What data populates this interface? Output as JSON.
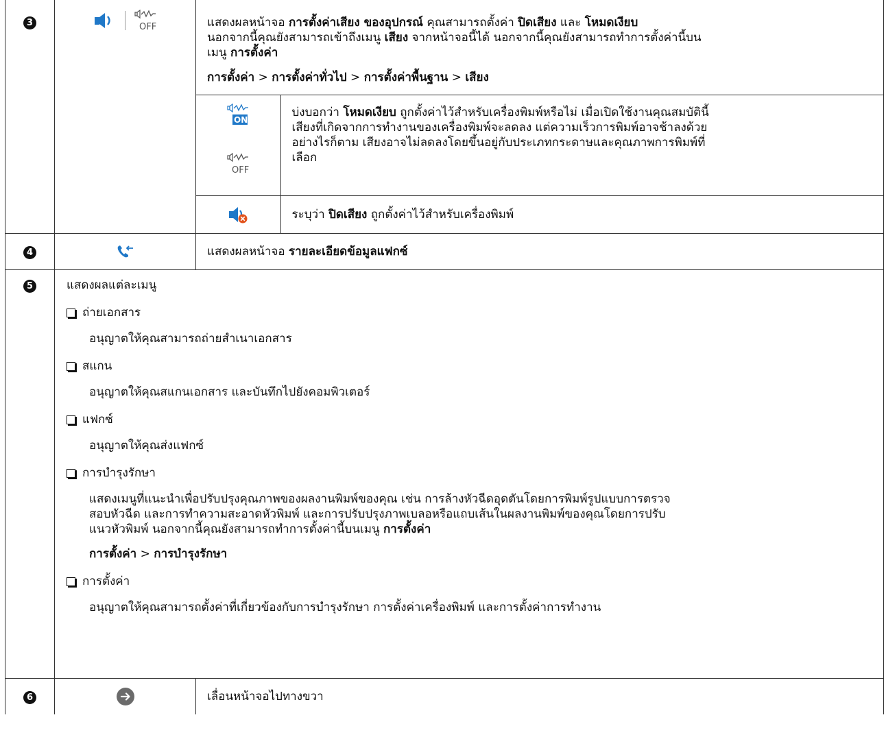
{
  "rows": [
    {
      "num": "3",
      "desc_line1": {
        "t1": "แสดงผลหน้าจอ ",
        "b1": "การตั้งค่าเสียง ของอุปกรณ์",
        "t2": " คุณสามารถตั้งค่า ",
        "b2": "ปิดเสียง",
        "t3": " และ ",
        "b3": "โหมดเงียบ"
      },
      "desc_line2": {
        "t1": "นอกจากนี้คุณยังสามารถเข้าถึงเมนู ",
        "b1": "เสียง",
        "t2": " จากหน้าจอนี้ได้ นอกจากนี้คุณยังสามารถทำการตั้งค่านี้บน"
      },
      "desc_line3": {
        "t1": "เมนู ",
        "b1": "การตั้งค่า"
      },
      "path": {
        "p1": "การตั้งค่า",
        "sep": " > ",
        "p2": "การตั้งค่าทั่วไป",
        "p3": "การตั้งค่าพื้นฐาน",
        "p4": "เสียง"
      },
      "quiet_desc": {
        "t1": "บ่งบอกว่า ",
        "b1": "โหมดเงียบ",
        "t2": " ถูกตั้งค่าไว้สำหรับเครื่องพิมพ์หรือไม่ เมื่อเปิดใช้งานคุณสมบัตินี้",
        "l2": "เสียงที่เกิดจากการทำงานของเครื่องพิมพ์จะลดลง แต่ความเร็วการพิมพ์อาจช้าลงด้วย",
        "l3": "อย่างไรก็ตาม เสียงอาจไม่ลดลงโดยขึ้นอยู่กับประเภทกระดาษและคุณภาพการพิมพ์ที่",
        "l4": "เลือก"
      },
      "mute_desc": {
        "t1": "ระบุว่า ",
        "b1": "ปิดเสียง",
        "t2": " ถูกตั้งค่าไว้สำหรับเครื่องพิมพ์"
      },
      "icon_on_label": "ON",
      "icon_off_label": "OFF"
    },
    {
      "num": "4",
      "desc": {
        "t1": "แสดงผลหน้าจอ ",
        "b1": "รายละเอียดข้อมูลแฟกซ์"
      }
    },
    {
      "num": "5",
      "intro": "แสดงผลแต่ละเมนู",
      "items": [
        {
          "title": "ถ่ายเอกสาร",
          "desc": "อนุญาตให้คุณสามารถถ่ายสำเนาเอกสาร"
        },
        {
          "title": "สแกน",
          "desc": "อนุญาตให้คุณสแกนเอกสาร และบันทึกไปยังคอมพิวเตอร์"
        },
        {
          "title": "แฟกซ์",
          "desc": "อนุญาตให้คุณส่งแฟกซ์"
        },
        {
          "title": "การบำรุงรักษา",
          "l1": "แสดงเมนูที่แนะนำเพื่อปรับปรุงคุณภาพของผลงานพิมพ์ของคุณ เช่น การล้างหัวฉีดอุดตันโดยการพิมพ์รูปแบบการตรวจ",
          "l2": "สอบหัวฉีด และการทำความสะอาดหัวพิมพ์ และการปรับปรุงภาพเบลอหรือแถบเส้นในผลงานพิมพ์ของคุณโดยการปรับ",
          "l3": "แนวหัวพิมพ์ นอกจากนี้คุณยังสามารถทำการตั้งค่านี้บนเมนู ",
          "l3b": "การตั้งค่า",
          "path1": "การตั้งค่า",
          "sep": " > ",
          "path2": "การบำรุงรักษา"
        },
        {
          "title": "การตั้งค่า",
          "desc": "อนุญาตให้คุณสามารถตั้งค่าที่เกี่ยวข้องกับการบำรุงรักษา การตั้งค่าเครื่องพิมพ์ และการตั้งค่าการทำงาน"
        }
      ]
    },
    {
      "num": "6",
      "desc": "เลื่อนหน้าจอไปทางขวา"
    }
  ],
  "colors": {
    "icon_blue": "#1f78c8",
    "icon_gray": "#555555",
    "mute_orange": "#e2531d",
    "arrow_gray": "#6b6b6b"
  }
}
